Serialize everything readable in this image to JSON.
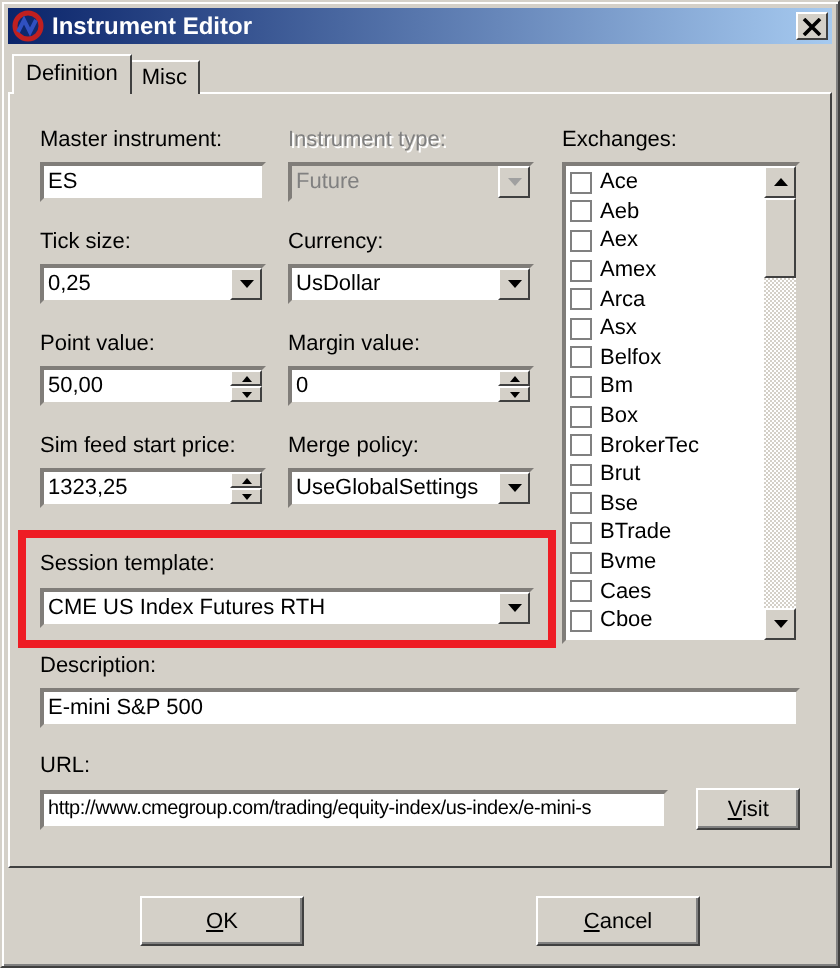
{
  "window": {
    "title": "Instrument Editor"
  },
  "tabs": [
    {
      "label": "Definition",
      "selected": true
    },
    {
      "label": "Misc",
      "selected": false
    }
  ],
  "fields": [
    {
      "label": "Master instrument:",
      "kind": "text",
      "value": "ES",
      "disabled": false
    },
    {
      "label": "Instrument type:",
      "kind": "combo",
      "value": "Future",
      "disabled": true
    },
    {
      "label": "Tick size:",
      "kind": "combo",
      "value": "0,25",
      "disabled": false
    },
    {
      "label": "Currency:",
      "kind": "combo",
      "value": "UsDollar",
      "disabled": false
    },
    {
      "label": "Point value:",
      "kind": "spin",
      "value": "50,00",
      "disabled": false
    },
    {
      "label": "Margin value:",
      "kind": "spin",
      "value": "0",
      "disabled": false
    },
    {
      "label": "Sim feed start price:",
      "kind": "spin",
      "value": "1323,25",
      "disabled": false
    },
    {
      "label": "Merge policy:",
      "kind": "combo",
      "value": "UseGlobalSettings",
      "disabled": false
    }
  ],
  "session_template": {
    "label": "Session template:",
    "value": "CME US Index Futures RTH",
    "highlighted": true
  },
  "exchanges": {
    "label": "Exchanges:",
    "items": [
      {
        "name": "Ace",
        "checked": false
      },
      {
        "name": "Aeb",
        "checked": false
      },
      {
        "name": "Aex",
        "checked": false
      },
      {
        "name": "Amex",
        "checked": false
      },
      {
        "name": "Arca",
        "checked": false
      },
      {
        "name": "Asx",
        "checked": false
      },
      {
        "name": "Belfox",
        "checked": false
      },
      {
        "name": "Bm",
        "checked": false
      },
      {
        "name": "Box",
        "checked": false
      },
      {
        "name": "BrokerTec",
        "checked": false
      },
      {
        "name": "Brut",
        "checked": false
      },
      {
        "name": "Bse",
        "checked": false
      },
      {
        "name": "BTrade",
        "checked": false
      },
      {
        "name": "Bvme",
        "checked": false
      },
      {
        "name": "Caes",
        "checked": false
      },
      {
        "name": "Cboe",
        "checked": false
      }
    ]
  },
  "description": {
    "label": "Description:",
    "value": "E-mini S&P 500"
  },
  "url": {
    "label": "URL:",
    "value": "http://www.cmegroup.com/trading/equity-index/us-index/e-mini-s",
    "button": {
      "label": "Visit",
      "mnemonic": true
    }
  },
  "buttons": [
    {
      "label": "OK",
      "mnemonic": true
    },
    {
      "label": "Cancel",
      "mnemonic": true
    }
  ]
}
